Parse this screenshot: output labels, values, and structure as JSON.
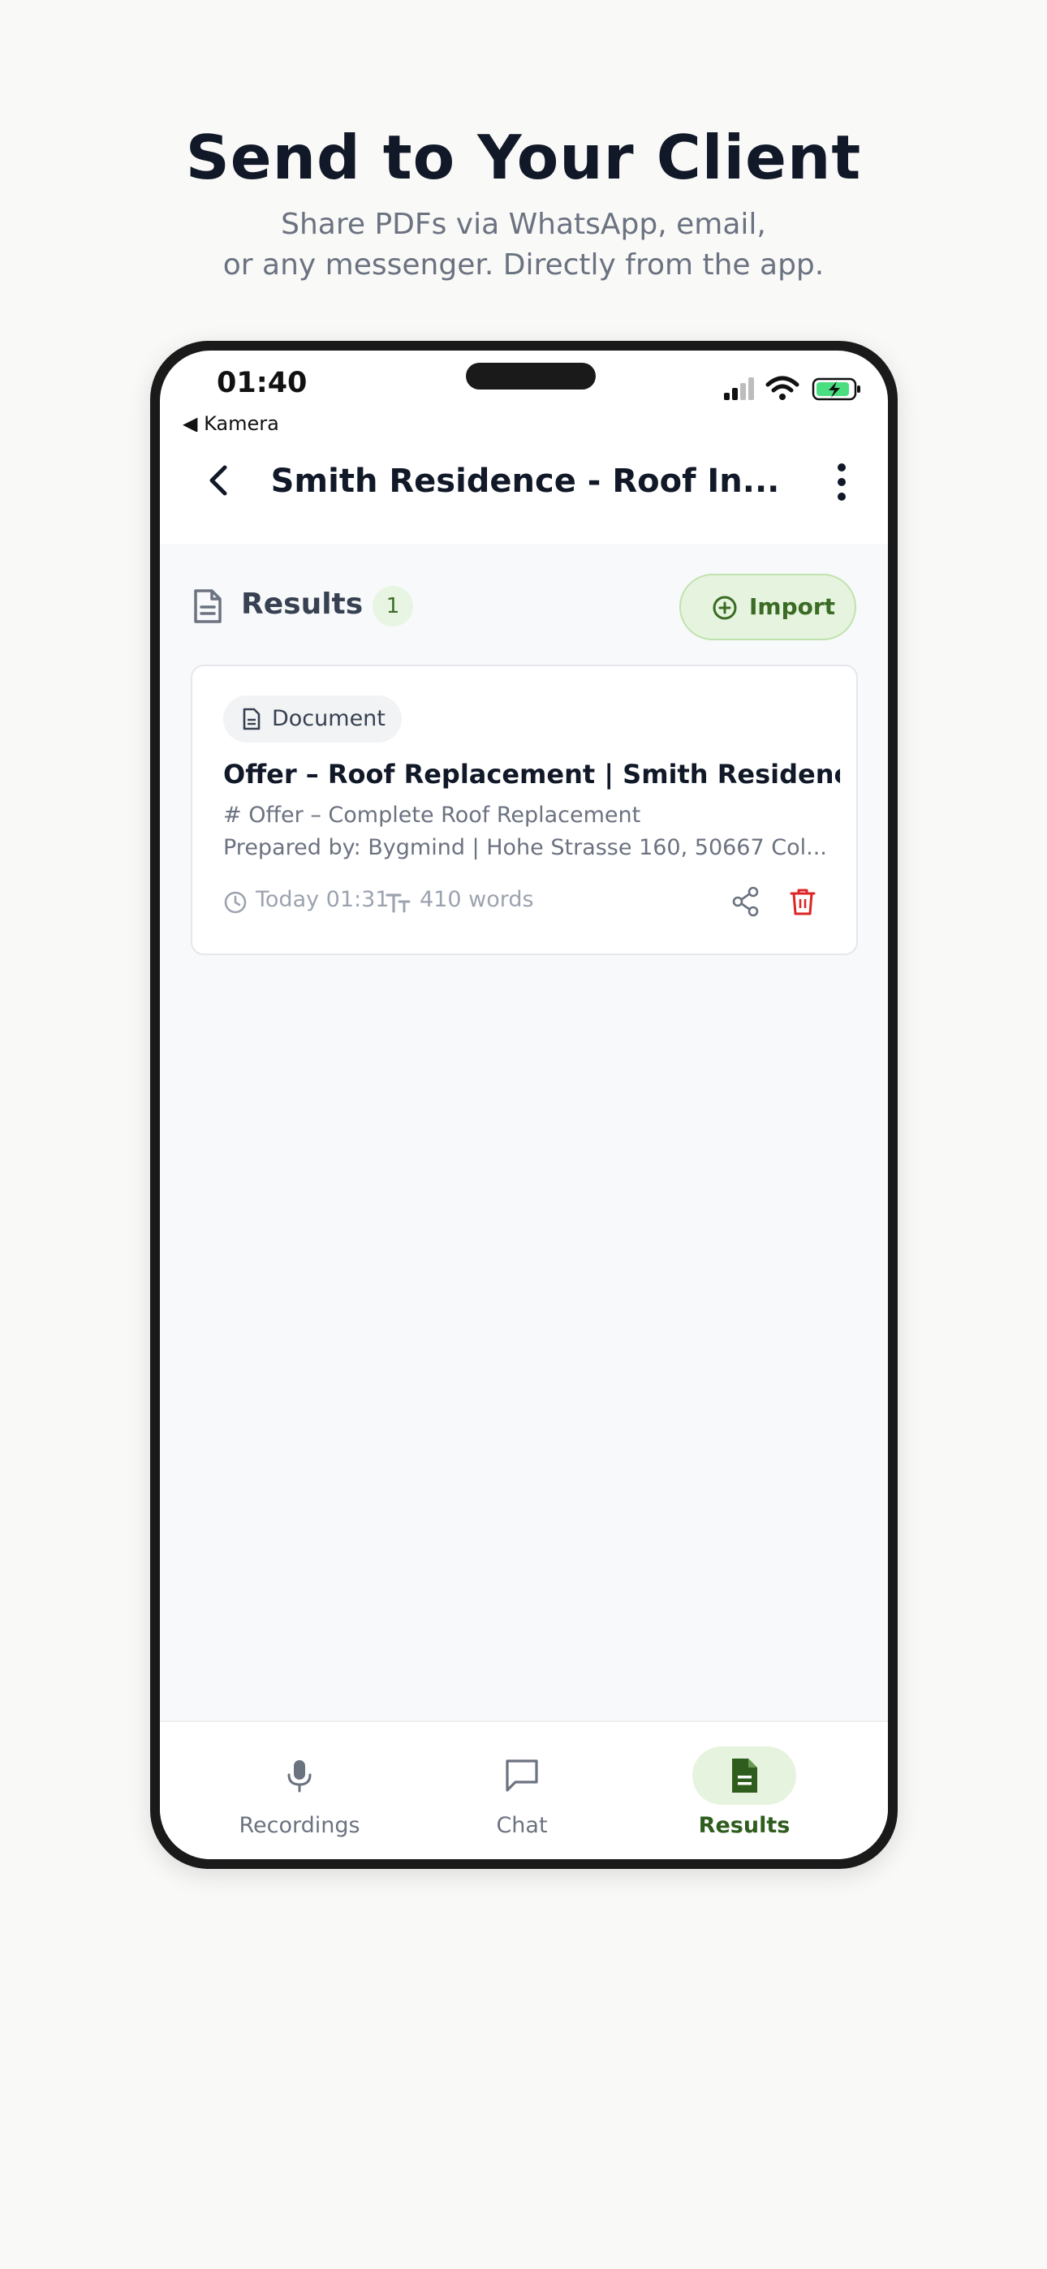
{
  "promo": {
    "title": "Send to Your Client",
    "subtitle_line1": "Share PDFs via WhatsApp, email,",
    "subtitle_line2": "or any messenger. Directly from the app."
  },
  "status_bar": {
    "time": "01:40",
    "back_app": "◀ Kamera",
    "icons": [
      "signal-icon",
      "wifi-icon",
      "battery-charging-icon"
    ]
  },
  "header": {
    "title": "Smith Residence - Roof In...",
    "back_icon": "chevron-left-icon",
    "menu_icon": "more-vertical-icon"
  },
  "results": {
    "label": "Results",
    "count": "1",
    "import_label": "Import",
    "import_icon": "plus-circle-icon"
  },
  "card": {
    "type_label": "Document",
    "title": "Offer – Roof Replacement | Smith Residence",
    "preview_line1": "# Offer – Complete Roof Replacement",
    "preview_line2": "Prepared by: Bygmind | Hohe Strasse 160, 50667 Col...",
    "time": "Today 01:31",
    "words": "410 words",
    "share_icon": "share-icon",
    "delete_icon": "trash-icon"
  },
  "tabs": [
    {
      "label": "Recordings",
      "icon": "microphone-icon",
      "active": false
    },
    {
      "label": "Chat",
      "icon": "chat-bubble-icon",
      "active": false
    },
    {
      "label": "Results",
      "icon": "document-icon",
      "active": true
    }
  ],
  "colors": {
    "accent_green": "#3b6b24",
    "accent_green_bg": "#e6f4df",
    "delete_red": "#dc2626",
    "text_dark": "#111827"
  }
}
